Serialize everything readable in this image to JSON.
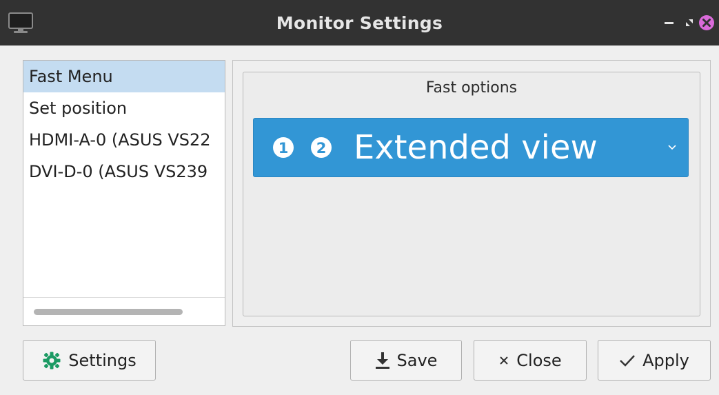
{
  "window": {
    "title": "Monitor Settings",
    "title_icon": "monitor-icon",
    "controls": [
      "minimize-icon",
      "maximize-icon",
      "close-icon"
    ]
  },
  "sidebar": {
    "items": [
      {
        "label": "Fast Menu",
        "selected": true
      },
      {
        "label": "Set position",
        "selected": false
      },
      {
        "label": "HDMI-A-0 (ASUS VS22",
        "selected": false
      },
      {
        "label": "DVI-D-0 (ASUS VS239",
        "selected": false
      }
    ]
  },
  "fast_options": {
    "title": "Fast options",
    "mode_select": {
      "value": "Extended view",
      "icons": [
        "monitor-1-icon",
        "monitor-2-icon"
      ],
      "background": "#3296d5"
    }
  },
  "buttons": {
    "settings": {
      "label": "Settings",
      "icon": "settings-gear-icon"
    },
    "save": {
      "label": "Save",
      "icon": "download-icon"
    },
    "close": {
      "label": "Close",
      "icon": "x-icon"
    },
    "apply": {
      "label": "Apply",
      "icon": "checkmark-icon"
    }
  },
  "colors": {
    "titlebar": "#323232",
    "selection": "#c4dcf1",
    "accent": "#3296d5",
    "window_close": "#d96ad9"
  }
}
